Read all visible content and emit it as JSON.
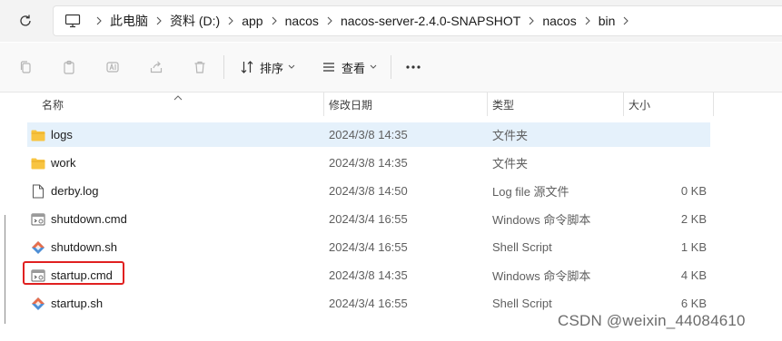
{
  "breadcrumb": [
    "此电脑",
    "资料 (D:)",
    "app",
    "nacos",
    "nacos-server-2.4.0-SNAPSHOT",
    "nacos",
    "bin"
  ],
  "toolbar": {
    "sort_label": "排序",
    "view_label": "查看"
  },
  "columns": {
    "name": "名称",
    "date": "修改日期",
    "type": "类型",
    "size": "大小"
  },
  "files": [
    {
      "name": "logs",
      "date": "2024/3/8 14:35",
      "type": "文件夹",
      "size": "",
      "icon": "folder-icon"
    },
    {
      "name": "work",
      "date": "2024/3/8 14:35",
      "type": "文件夹",
      "size": "",
      "icon": "folder-icon"
    },
    {
      "name": "derby.log",
      "date": "2024/3/8 14:50",
      "type": "Log file 源文件",
      "size": "0 KB",
      "icon": "text-file-icon"
    },
    {
      "name": "shutdown.cmd",
      "date": "2024/3/4 16:55",
      "type": "Windows 命令脚本",
      "size": "2 KB",
      "icon": "cmd-file-icon"
    },
    {
      "name": "shutdown.sh",
      "date": "2024/3/4 16:55",
      "type": "Shell Script",
      "size": "1 KB",
      "icon": "git-shell-icon"
    },
    {
      "name": "startup.cmd",
      "date": "2024/3/8 14:35",
      "type": "Windows 命令脚本",
      "size": "4 KB",
      "icon": "cmd-file-icon"
    },
    {
      "name": "startup.sh",
      "date": "2024/3/4 16:55",
      "type": "Shell Script",
      "size": "6 KB",
      "icon": "git-shell-icon"
    }
  ],
  "selected_row": "logs",
  "highlighted_file": "startup.cmd",
  "highlight_color": "#e02020",
  "selection_color": "#e5f1fb",
  "folder_color": "#f8c440",
  "watermark": "CSDN @weixin_44084610"
}
